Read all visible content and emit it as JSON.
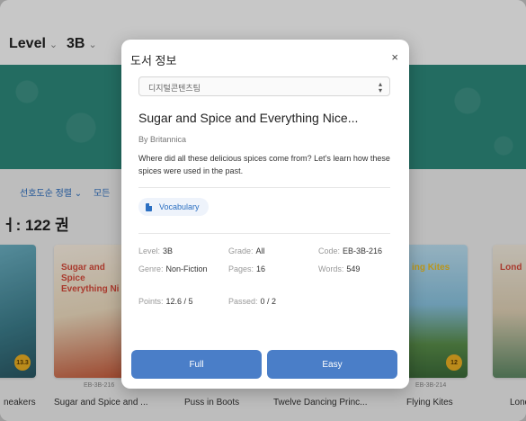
{
  "header": {
    "level_label": "Level",
    "grade_label": "3B"
  },
  "toolbar": {
    "sort_label": "선호도순 정렬",
    "all_label": "모든"
  },
  "results": {
    "count_text": "ㅓ: 122 권"
  },
  "books": [
    {
      "title": "neakers",
      "code": "",
      "cover_text": "",
      "badge": "13.3"
    },
    {
      "title": "Sugar and Spice and ...",
      "code": "EB-3B-216",
      "cover_text": "Sugar and Spice Everything Ni"
    },
    {
      "title": "Puss in Boots",
      "code": ""
    },
    {
      "title": "Twelve Dancing Princ...",
      "code": ""
    },
    {
      "title": "Flying Kites",
      "code": "EB-3B-214",
      "cover_text": "ing Kites",
      "badge": "12"
    },
    {
      "title": "Lond",
      "code": "",
      "cover_text": "Lond"
    }
  ],
  "modal": {
    "title": "도서 정보",
    "close_label": "×",
    "select_value": "디지털콘텐츠팀",
    "book_title": "Sugar and Spice and Everything Nice...",
    "author": "By Britannica",
    "description": "Where did all these delicious spices come from? Let's learn how these spices were used in the past.",
    "chip_label": "Vocabulary",
    "meta": {
      "level_k": "Level:",
      "level_v": "3B",
      "grade_k": "Grade:",
      "grade_v": "All",
      "code_k": "Code:",
      "code_v": "EB-3B-216",
      "genre_k": "Genre:",
      "genre_v": "Non-Fiction",
      "pages_k": "Pages:",
      "pages_v": "16",
      "words_k": "Words:",
      "words_v": "549",
      "points_k": "Points:",
      "points_v": "12.6 / 5",
      "passed_k": "Passed:",
      "passed_v": "0 / 2"
    },
    "buttons": {
      "full": "Full",
      "easy": "Easy"
    }
  },
  "colors": {
    "accent": "#4a7ec8",
    "banner": "#2e8b7d"
  }
}
